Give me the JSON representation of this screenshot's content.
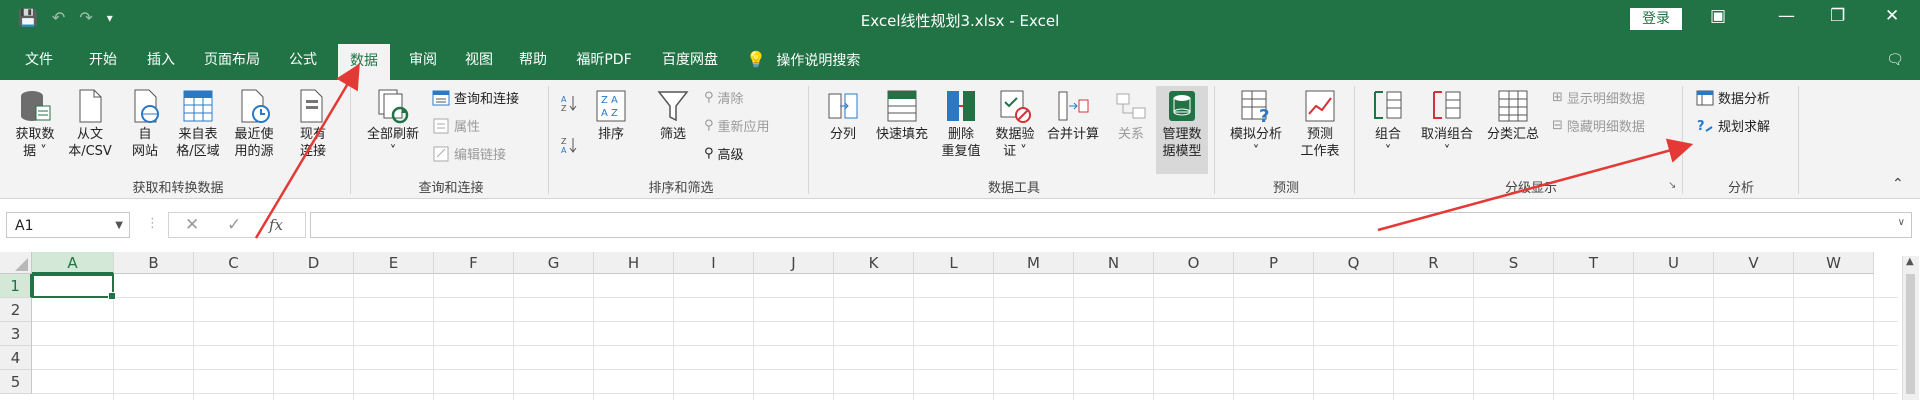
{
  "window": {
    "title": "Excel线性规划3.xlsx  -  Excel",
    "login_label": "登录"
  },
  "qat": {
    "save_icon": "save-icon",
    "undo_icon": "undo-icon",
    "redo_icon": "redo-icon",
    "customize_icon": "customize-qat-icon"
  },
  "tabs": [
    "文件",
    "开始",
    "插入",
    "页面布局",
    "公式",
    "数据",
    "审阅",
    "视图",
    "帮助",
    "福昕PDF",
    "百度网盘",
    "操作说明搜索"
  ],
  "active_tab": "数据",
  "ribbon": {
    "groups": {
      "get_transform": "获取和转换数据",
      "queries": "查询和连接",
      "sort_filter": "排序和筛选",
      "data_tools": "数据工具",
      "forecast": "预测",
      "outline": "分级显示",
      "analysis": "分析"
    },
    "get": {
      "get_data": [
        "获取数",
        "据 ˅"
      ],
      "from_csv": [
        "从文",
        "本/CSV"
      ],
      "from_web": [
        "自",
        "网站"
      ],
      "from_table": [
        "来自表",
        "格/区域"
      ],
      "recent": [
        "最近使",
        "用的源"
      ],
      "existing": [
        "现有",
        "连接"
      ]
    },
    "queries": {
      "refresh_all": [
        "全部刷新",
        "˅"
      ],
      "query_conn": "查询和连接",
      "properties": "属性",
      "edit_links": "编辑链接"
    },
    "sort": {
      "sort": "排序",
      "filter": "筛选",
      "clear": "清除",
      "reapply": "重新应用",
      "advanced": "高级"
    },
    "tools": {
      "split": "分列",
      "flash_fill": "快速填充",
      "remove_dup": [
        "删除",
        "重复值"
      ],
      "validation": [
        "数据验",
        "证 ˅"
      ],
      "consolidate": "合并计算",
      "relations": "关系",
      "data_model": [
        "管理数",
        "据模型"
      ]
    },
    "forecast": {
      "what_if": [
        "模拟分析",
        "˅"
      ],
      "sheet": [
        "预测",
        "工作表"
      ]
    },
    "outline": {
      "group": [
        "组合",
        "˅"
      ],
      "ungroup": [
        "取消组合",
        "˅"
      ],
      "subtotal": "分类汇总",
      "show_detail": "显示明细数据",
      "hide_detail": "隐藏明细数据"
    },
    "analysis": {
      "data_analysis": "数据分析",
      "solver": "规划求解"
    }
  },
  "formula_bar": {
    "name_box": "A1",
    "cancel_icon": "cancel-icon",
    "enter_icon": "enter-icon",
    "fx": "fx",
    "value": ""
  },
  "grid": {
    "columns": [
      "A",
      "B",
      "C",
      "D",
      "E",
      "F",
      "G",
      "H",
      "I",
      "J",
      "K",
      "L",
      "M",
      "N",
      "O",
      "P",
      "Q",
      "R",
      "S",
      "T",
      "U",
      "V",
      "W"
    ],
    "rows": [
      "1",
      "2",
      "3",
      "4",
      "5"
    ],
    "selected_cell": "A1"
  },
  "colors": {
    "brand": "#217346",
    "annotation": "#e53935"
  }
}
